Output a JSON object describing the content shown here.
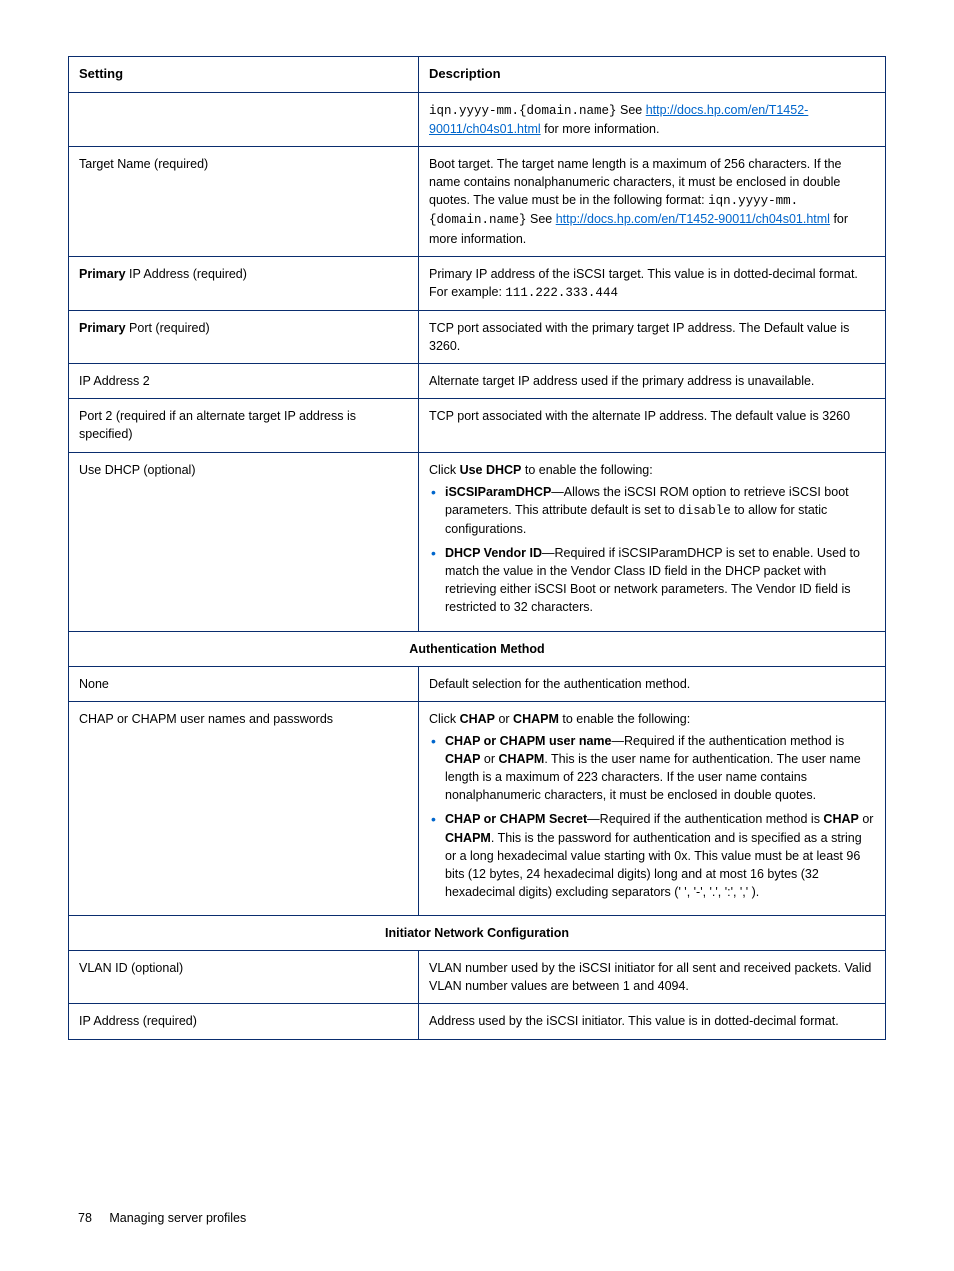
{
  "headers": {
    "setting": "Setting",
    "description": "Description"
  },
  "rows": {
    "r0_desc_html": "<span class=\"mono\">iqn.yyyy-mm.{domain.name}</span> See <a class=\"link\" data-name=\"link-docs-1\" data-interactable=\"true\" href=\"#\">http://docs.hp.com/en/T1452-90011/ch04s01.html</a> for more information.",
    "r1_setting": "Target Name (required)",
    "r1_desc_html": "Boot target. The target name length is a maximum of 256 characters. If the name contains nonalphanumeric characters, it must be enclosed in double quotes. The value must be in the following format: <span class=\"mono\">iqn.yyyy-mm.{domain.name}</span> See <a class=\"link\" data-name=\"link-docs-2\" data-interactable=\"true\" href=\"#\">http://docs.hp.com/en/T1452-90011/ch04s01.html</a> for more information.",
    "r2_setting_html": "<b>Primary</b> IP Address (required)",
    "r2_desc_html": "Primary IP address of the iSCSI target. This value is in dotted-decimal format. For example: <span class=\"mono\">111.222.333.444</span>",
    "r3_setting_html": "<b>Primary</b> Port (required)",
    "r3_desc": "TCP port associated with the primary target IP address. The Default value is 3260.",
    "r4_setting": "IP Address 2",
    "r4_desc": "Alternate target IP address used if the primary address is unavailable.",
    "r5_setting": "Port 2 (required if an alternate target IP address is specified)",
    "r5_desc": "TCP port associated with the alternate IP address. The default value is 3260",
    "r6_setting": "Use DHCP (optional)",
    "r6_intro_html": "Click <b>Use DHCP</b> to enable the following:",
    "r6_b1_html": "<b>iSCSIParamDHCP</b>—Allows the iSCSI ROM option to retrieve iSCSI boot parameters. This attribute default is set to <span class=\"mono\">disable</span> to allow for static configurations.",
    "r6_b2_html": "<b>DHCP Vendor ID</b>—Required if iSCSIParamDHCP is set to enable. Used to match the value in the Vendor Class ID field in the DHCP packet with retrieving either iSCSI Boot or network parameters. The Vendor ID field is restricted to 32 characters.",
    "sec1": "Authentication Method",
    "r7_setting": "None",
    "r7_desc": "Default selection for the authentication method.",
    "r8_setting": "CHAP or CHAPM user names and passwords",
    "r8_intro_html": "Click <b>CHAP</b> or <b>CHAPM</b> to enable the following:",
    "r8_b1_html": "<b>CHAP or CHAPM user name</b>—Required if the authentication method is <b>CHAP</b> or <b>CHAPM</b>. This is the user name for authentication. The user name length is a maximum of 223 characters. If the user name contains nonalphanumeric characters, it must be enclosed in double quotes.",
    "r8_b2_html": "<b>CHAP or CHAPM Secret</b>—Required if the authentication method is <b>CHAP</b> or <b>CHAPM</b>. This is the password for authentication and is specified as a string or a long hexadecimal value starting with 0x. This value must be at least 96 bits (12 bytes, 24 hexadecimal digits) long and at most 16 bytes (32 hexadecimal digits) excluding separators (' ', '-', '.', ':', ',' ).",
    "sec2": "Initiator Network Configuration",
    "r9_setting": "VLAN ID (optional)",
    "r9_desc": "VLAN number used by the iSCSI initiator for all sent and received packets. Valid VLAN number values are between 1 and 4094.",
    "r10_setting": "IP Address (required)",
    "r10_desc": "Address used by the iSCSI initiator. This value is in dotted-decimal format."
  },
  "footer": {
    "page": "78",
    "title": "Managing server profiles"
  }
}
